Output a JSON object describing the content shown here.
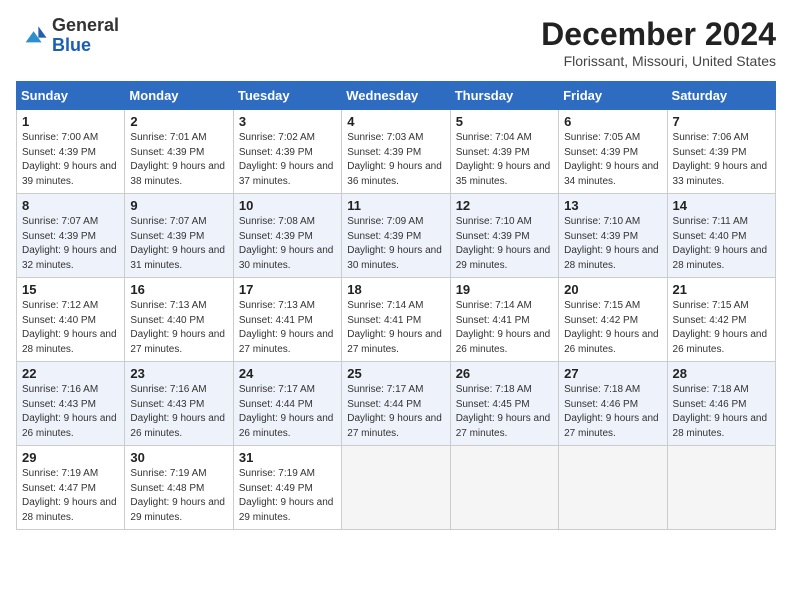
{
  "header": {
    "logo_line1": "General",
    "logo_line2": "Blue",
    "month": "December 2024",
    "location": "Florissant, Missouri, United States"
  },
  "weekdays": [
    "Sunday",
    "Monday",
    "Tuesday",
    "Wednesday",
    "Thursday",
    "Friday",
    "Saturday"
  ],
  "weeks": [
    [
      {
        "day": "1",
        "sunrise": "7:00 AM",
        "sunset": "4:39 PM",
        "daylight": "9 hours and 39 minutes."
      },
      {
        "day": "2",
        "sunrise": "7:01 AM",
        "sunset": "4:39 PM",
        "daylight": "9 hours and 38 minutes."
      },
      {
        "day": "3",
        "sunrise": "7:02 AM",
        "sunset": "4:39 PM",
        "daylight": "9 hours and 37 minutes."
      },
      {
        "day": "4",
        "sunrise": "7:03 AM",
        "sunset": "4:39 PM",
        "daylight": "9 hours and 36 minutes."
      },
      {
        "day": "5",
        "sunrise": "7:04 AM",
        "sunset": "4:39 PM",
        "daylight": "9 hours and 35 minutes."
      },
      {
        "day": "6",
        "sunrise": "7:05 AM",
        "sunset": "4:39 PM",
        "daylight": "9 hours and 34 minutes."
      },
      {
        "day": "7",
        "sunrise": "7:06 AM",
        "sunset": "4:39 PM",
        "daylight": "9 hours and 33 minutes."
      }
    ],
    [
      {
        "day": "8",
        "sunrise": "7:07 AM",
        "sunset": "4:39 PM",
        "daylight": "9 hours and 32 minutes."
      },
      {
        "day": "9",
        "sunrise": "7:07 AM",
        "sunset": "4:39 PM",
        "daylight": "9 hours and 31 minutes."
      },
      {
        "day": "10",
        "sunrise": "7:08 AM",
        "sunset": "4:39 PM",
        "daylight": "9 hours and 30 minutes."
      },
      {
        "day": "11",
        "sunrise": "7:09 AM",
        "sunset": "4:39 PM",
        "daylight": "9 hours and 30 minutes."
      },
      {
        "day": "12",
        "sunrise": "7:10 AM",
        "sunset": "4:39 PM",
        "daylight": "9 hours and 29 minutes."
      },
      {
        "day": "13",
        "sunrise": "7:10 AM",
        "sunset": "4:39 PM",
        "daylight": "9 hours and 28 minutes."
      },
      {
        "day": "14",
        "sunrise": "7:11 AM",
        "sunset": "4:40 PM",
        "daylight": "9 hours and 28 minutes."
      }
    ],
    [
      {
        "day": "15",
        "sunrise": "7:12 AM",
        "sunset": "4:40 PM",
        "daylight": "9 hours and 28 minutes."
      },
      {
        "day": "16",
        "sunrise": "7:13 AM",
        "sunset": "4:40 PM",
        "daylight": "9 hours and 27 minutes."
      },
      {
        "day": "17",
        "sunrise": "7:13 AM",
        "sunset": "4:41 PM",
        "daylight": "9 hours and 27 minutes."
      },
      {
        "day": "18",
        "sunrise": "7:14 AM",
        "sunset": "4:41 PM",
        "daylight": "9 hours and 27 minutes."
      },
      {
        "day": "19",
        "sunrise": "7:14 AM",
        "sunset": "4:41 PM",
        "daylight": "9 hours and 26 minutes."
      },
      {
        "day": "20",
        "sunrise": "7:15 AM",
        "sunset": "4:42 PM",
        "daylight": "9 hours and 26 minutes."
      },
      {
        "day": "21",
        "sunrise": "7:15 AM",
        "sunset": "4:42 PM",
        "daylight": "9 hours and 26 minutes."
      }
    ],
    [
      {
        "day": "22",
        "sunrise": "7:16 AM",
        "sunset": "4:43 PM",
        "daylight": "9 hours and 26 minutes."
      },
      {
        "day": "23",
        "sunrise": "7:16 AM",
        "sunset": "4:43 PM",
        "daylight": "9 hours and 26 minutes."
      },
      {
        "day": "24",
        "sunrise": "7:17 AM",
        "sunset": "4:44 PM",
        "daylight": "9 hours and 26 minutes."
      },
      {
        "day": "25",
        "sunrise": "7:17 AM",
        "sunset": "4:44 PM",
        "daylight": "9 hours and 27 minutes."
      },
      {
        "day": "26",
        "sunrise": "7:18 AM",
        "sunset": "4:45 PM",
        "daylight": "9 hours and 27 minutes."
      },
      {
        "day": "27",
        "sunrise": "7:18 AM",
        "sunset": "4:46 PM",
        "daylight": "9 hours and 27 minutes."
      },
      {
        "day": "28",
        "sunrise": "7:18 AM",
        "sunset": "4:46 PM",
        "daylight": "9 hours and 28 minutes."
      }
    ],
    [
      {
        "day": "29",
        "sunrise": "7:19 AM",
        "sunset": "4:47 PM",
        "daylight": "9 hours and 28 minutes."
      },
      {
        "day": "30",
        "sunrise": "7:19 AM",
        "sunset": "4:48 PM",
        "daylight": "9 hours and 29 minutes."
      },
      {
        "day": "31",
        "sunrise": "7:19 AM",
        "sunset": "4:49 PM",
        "daylight": "9 hours and 29 minutes."
      },
      null,
      null,
      null,
      null
    ]
  ]
}
